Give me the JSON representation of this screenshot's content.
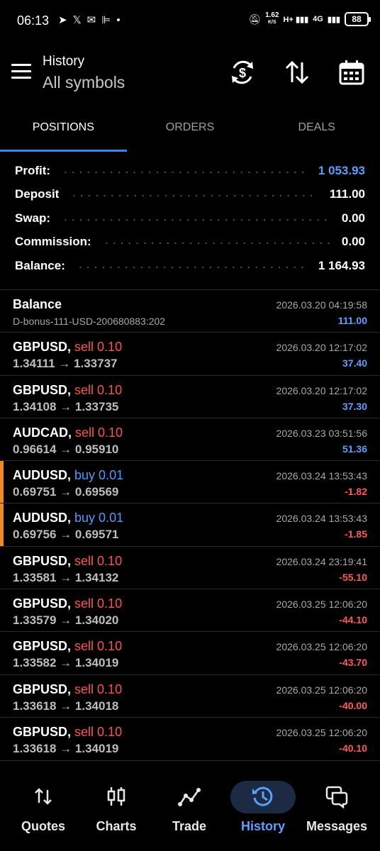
{
  "status_bar": {
    "time": "06:13",
    "speed_value": "1.62",
    "speed_unit": "K/S",
    "network": "4G",
    "battery": "88"
  },
  "header": {
    "title": "History",
    "subtitle": "All symbols"
  },
  "tabs": [
    {
      "label": "POSITIONS",
      "active": true
    },
    {
      "label": "ORDERS",
      "active": false
    },
    {
      "label": "DEALS",
      "active": false
    }
  ],
  "summary": [
    {
      "label": "Profit:",
      "value": "1 053.93",
      "color": "#5aa0ff"
    },
    {
      "label": "Deposit",
      "value": "111.00",
      "color": "#ffffff"
    },
    {
      "label": "Swap:",
      "value": "0.00",
      "color": "#ffffff"
    },
    {
      "label": "Commission:",
      "value": "0.00",
      "color": "#ffffff"
    },
    {
      "label": "Balance:",
      "value": "1 164.93",
      "color": "#ffffff"
    }
  ],
  "rows": [
    {
      "symbol": "Balance",
      "side": "",
      "side_type": "",
      "detail": "D-bonus-111-USD-200680883:202",
      "time": "2026.03.20 04:19:58",
      "profit": "111.00",
      "sign": "pos",
      "highlight": false
    },
    {
      "symbol": "GBPUSD,",
      "side": "sell 0.10",
      "side_type": "sell",
      "detail": "1.34111 → 1.33737",
      "time": "2026.03.20 12:17:02",
      "profit": "37.40",
      "sign": "pos",
      "highlight": false
    },
    {
      "symbol": "GBPUSD,",
      "side": "sell 0.10",
      "side_type": "sell",
      "detail": "1.34108 → 1.33735",
      "time": "2026.03.20 12:17:02",
      "profit": "37.30",
      "sign": "pos",
      "highlight": false
    },
    {
      "symbol": "AUDCAD,",
      "side": "sell 0.10",
      "side_type": "sell",
      "detail": "0.96614 → 0.95910",
      "time": "2026.03.23 03:51:56",
      "profit": "51.36",
      "sign": "pos",
      "highlight": false
    },
    {
      "symbol": "AUDUSD,",
      "side": "buy 0.01",
      "side_type": "buy",
      "detail": "0.69751 → 0.69569",
      "time": "2026.03.24 13:53:43",
      "profit": "-1.82",
      "sign": "neg",
      "highlight": true
    },
    {
      "symbol": "AUDUSD,",
      "side": "buy 0.01",
      "side_type": "buy",
      "detail": "0.69756 → 0.69571",
      "time": "2026.03.24 13:53:43",
      "profit": "-1.85",
      "sign": "neg",
      "highlight": true
    },
    {
      "symbol": "GBPUSD,",
      "side": "sell 0.10",
      "side_type": "sell",
      "detail": "1.33581 → 1.34132",
      "time": "2026.03.24 23:19:41",
      "profit": "-55.10",
      "sign": "neg",
      "highlight": false
    },
    {
      "symbol": "GBPUSD,",
      "side": "sell 0.10",
      "side_type": "sell",
      "detail": "1.33579 → 1.34020",
      "time": "2026.03.25 12:06:20",
      "profit": "-44.10",
      "sign": "neg",
      "highlight": false
    },
    {
      "symbol": "GBPUSD,",
      "side": "sell 0.10",
      "side_type": "sell",
      "detail": "1.33582 → 1.34019",
      "time": "2026.03.25 12:06:20",
      "profit": "-43.70",
      "sign": "neg",
      "highlight": false
    },
    {
      "symbol": "GBPUSD,",
      "side": "sell 0.10",
      "side_type": "sell",
      "detail": "1.33618 → 1.34018",
      "time": "2026.03.25 12:06:20",
      "profit": "-40.00",
      "sign": "neg",
      "highlight": false
    },
    {
      "symbol": "GBPUSD,",
      "side": "sell 0.10",
      "side_type": "sell",
      "detail": "1.33618 → 1.34019",
      "time": "2026.03.25 12:06:20",
      "profit": "-40.10",
      "sign": "neg",
      "highlight": false
    }
  ],
  "bottom_nav": [
    {
      "label": "Quotes",
      "icon": "arrows-up-down-icon",
      "active": false
    },
    {
      "label": "Charts",
      "icon": "candlestick-icon",
      "active": false
    },
    {
      "label": "Trade",
      "icon": "trade-line-icon",
      "active": false
    },
    {
      "label": "History",
      "icon": "history-clock-icon",
      "active": true
    },
    {
      "label": "Messages",
      "icon": "messages-icon",
      "active": false
    }
  ],
  "colors": {
    "accent": "#3b82f0",
    "profit_positive": "#5aa0ff",
    "profit_negative": "#ff5a5a",
    "sell": "#ff5252",
    "buy": "#4d9bff",
    "highlight_bar": "#f08a24"
  }
}
